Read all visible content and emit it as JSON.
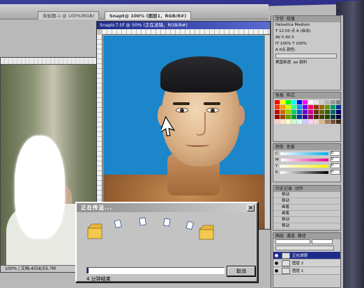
{
  "app": {
    "tabs": [
      {
        "label": "未标题-1 @ 100%(RGB)"
      },
      {
        "label": "Snapt@ 100% (图层1，RGB/8#)"
      }
    ],
    "main_doc_title": "Snaptc7.tif @ 50% (正在滤镜，RGB/8#)"
  },
  "left_doc": {
    "status": "100%  |  文档:455K/55.7M"
  },
  "palettes": {
    "character": {
      "tabs": [
        "字符",
        "段落"
      ],
      "rows": [
        "Helvetica  Medium",
        "T 12.50 点  A (自动)",
        "AV 0  AV 0",
        "IT 100%  T 100%",
        "A 0点  颜色:"
      ],
      "lang": "美国英语",
      "aa": "aa 锐利"
    },
    "swatches": {
      "tabs": [
        "色板",
        "样式"
      ],
      "colors": [
        "#ff0000",
        "#ffff00",
        "#00ff00",
        "#00ffff",
        "#0000ff",
        "#ff00ff",
        "#ffffff",
        "#e6e6e6",
        "#cccccc",
        "#b3b3b3",
        "#999999",
        "#808080",
        "#ff3300",
        "#ff9900",
        "#ccff00",
        "#33ff99",
        "#0099ff",
        "#6600ff",
        "#ff0066",
        "#993300",
        "#996600",
        "#669900",
        "#009966",
        "#003399",
        "#cc0000",
        "#cc6600",
        "#99cc00",
        "#00cc66",
        "#0066cc",
        "#6600cc",
        "#cc0099",
        "#663300",
        "#666600",
        "#336600",
        "#006666",
        "#000066",
        "#990000",
        "#994400",
        "#669900",
        "#009933",
        "#003399",
        "#330099",
        "#990066",
        "#4d2600",
        "#404000",
        "#1f4000",
        "#003333",
        "#000033",
        "#ffcccc",
        "#ffe5cc",
        "#ffffcc",
        "#ccffcc",
        "#ccffff",
        "#ccccff",
        "#ffccff",
        "#f2d9c4",
        "#d9b38c",
        "#a67c52",
        "#735039",
        "#402a1a"
      ]
    },
    "color": {
      "tabs": [
        "颜色",
        "色板"
      ],
      "channels": [
        {
          "label": "C",
          "value": "0",
          "grad": "linear-gradient(90deg,#fff,#00aeef)"
        },
        {
          "label": "M",
          "value": "0",
          "grad": "linear-gradient(90deg,#fff,#ec008c)"
        },
        {
          "label": "Y",
          "value": "0",
          "grad": "linear-gradient(90deg,#fff,#fff200)"
        },
        {
          "label": "K",
          "value": "0",
          "grad": "linear-gradient(90deg,#fff,#000)"
        }
      ]
    },
    "history": {
      "tabs": [
        "历史记录",
        "动作"
      ],
      "items": [
        "移动",
        "移动",
        "画笔",
        "画笔",
        "移动",
        "移动"
      ]
    },
    "layers": {
      "tabs": [
        "图层",
        "通道",
        "路径"
      ],
      "items": [
        {
          "name": "正在滤镜",
          "selected": true
        },
        {
          "name": "图层 2",
          "selected": false
        },
        {
          "name": "图层 1",
          "selected": false
        }
      ]
    }
  },
  "dialog": {
    "title": "正在传送...",
    "close_icon": "close-icon",
    "progress": 0.01,
    "status": "4 分钟结束",
    "cancel": "取消"
  }
}
